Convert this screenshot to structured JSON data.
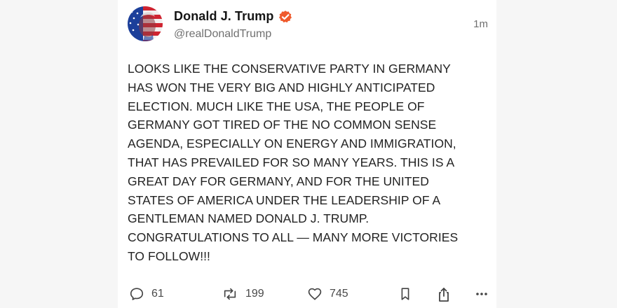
{
  "post": {
    "author": {
      "name": "Donald J. Trump",
      "handle": "@realDonaldTrump",
      "verified": true,
      "verified_color": "#ef5a2c"
    },
    "time": "1m",
    "text": "LOOKS LIKE THE CONSERVATIVE PARTY IN GERMANY\nHAS WON THE VERY BIG AND HIGHLY ANTICIPATED\nELECTION. MUCH LIKE THE USA, THE PEOPLE OF\nGERMANY GOT TIRED OF THE NO COMMON SENSE\nAGENDA, ESPECIALLY ON ENERGY AND IMMIGRATION,\nTHAT HAS PREVAILED FOR SO MANY YEARS. THIS IS A\nGREAT DAY FOR GERMANY, AND FOR THE UNITED\nSTATES OF AMERICA UNDER THE LEADERSHIP OF A\nGENTLEMAN NAMED DONALD J. TRUMP.\nCONGRATULATIONS TO ALL — MANY MORE VICTORIES\nTO FOLLOW!!!",
    "stats": {
      "replies": "61",
      "restates": "199",
      "likes": "745"
    }
  },
  "icons": {
    "avatar": "flag-portrait-avatar",
    "verified": "verified-badge-icon",
    "reply": "speech-bubble-icon",
    "restate": "repost-arrows-icon",
    "like": "heart-icon",
    "bookmark": "bookmark-icon",
    "share": "share-icon",
    "more": "more-dots-icon"
  },
  "colors": {
    "background": "#f6f6f6",
    "card": "#ffffff",
    "text": "#232323",
    "secondary": "#707070"
  }
}
